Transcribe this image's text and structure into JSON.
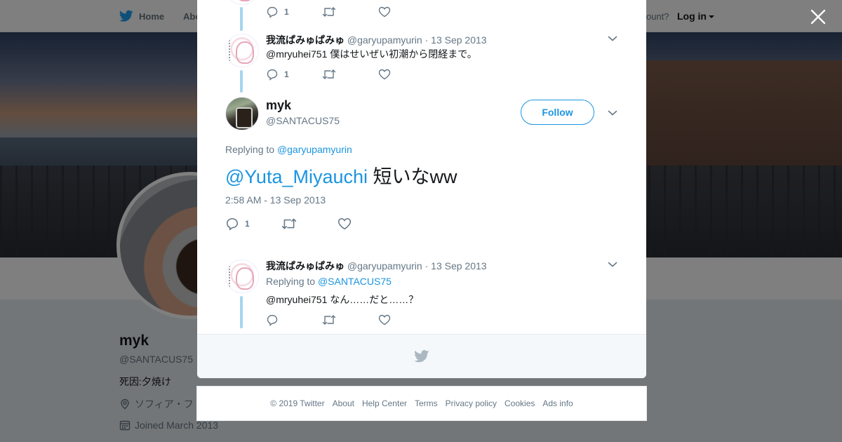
{
  "topbar": {
    "home_label": "Home",
    "about_label": "Abo",
    "account_question": "ccount?",
    "login_label": "Log in"
  },
  "profile": {
    "name": "myk",
    "handle": "@SANTACUS75",
    "bio": "死因:夕焼け",
    "location": "ソフィア・フ",
    "joined": "Joined March 2013"
  },
  "modal": {
    "tweets": [
      {
        "actions": {
          "reply_count": "1"
        }
      },
      {
        "display_name": "我流ぱみゅぱみゅ",
        "handle": "@garyupamyurin",
        "separator": "·",
        "date": "13 Sep 2013",
        "text": "@mryuhei751 僕はせいぜい初潮から閉経まで。",
        "actions": {
          "reply_count": "1"
        }
      }
    ],
    "main_tweet": {
      "display_name": "myk",
      "handle": "@SANTACUS75",
      "follow_label": "Follow",
      "replying_prefix": "Replying to",
      "replying_to": "@garyupamyurin",
      "mention": "@Yuta_Miyauchi",
      "text": " 短いなww",
      "timestamp": "2:58 AM - 13 Sep 2013",
      "reply_count": "1"
    },
    "reply_tweet": {
      "display_name": "我流ぱみゅぱみゅ",
      "handle": "@garyupamyurin",
      "separator": "·",
      "date": "13 Sep 2013",
      "replying_prefix": "Replying to",
      "replying_to": "@SANTACUS75",
      "text": "@mryuhei751 なん……だと……？"
    }
  },
  "footer": {
    "copyright": "© 2019 Twitter",
    "links": [
      "About",
      "Help Center",
      "Terms",
      "Privacy policy",
      "Cookies",
      "Ads info"
    ]
  },
  "colors": {
    "accent": "#1b95e0",
    "thread_line": "#a6d4ef",
    "muted": "#657786"
  }
}
